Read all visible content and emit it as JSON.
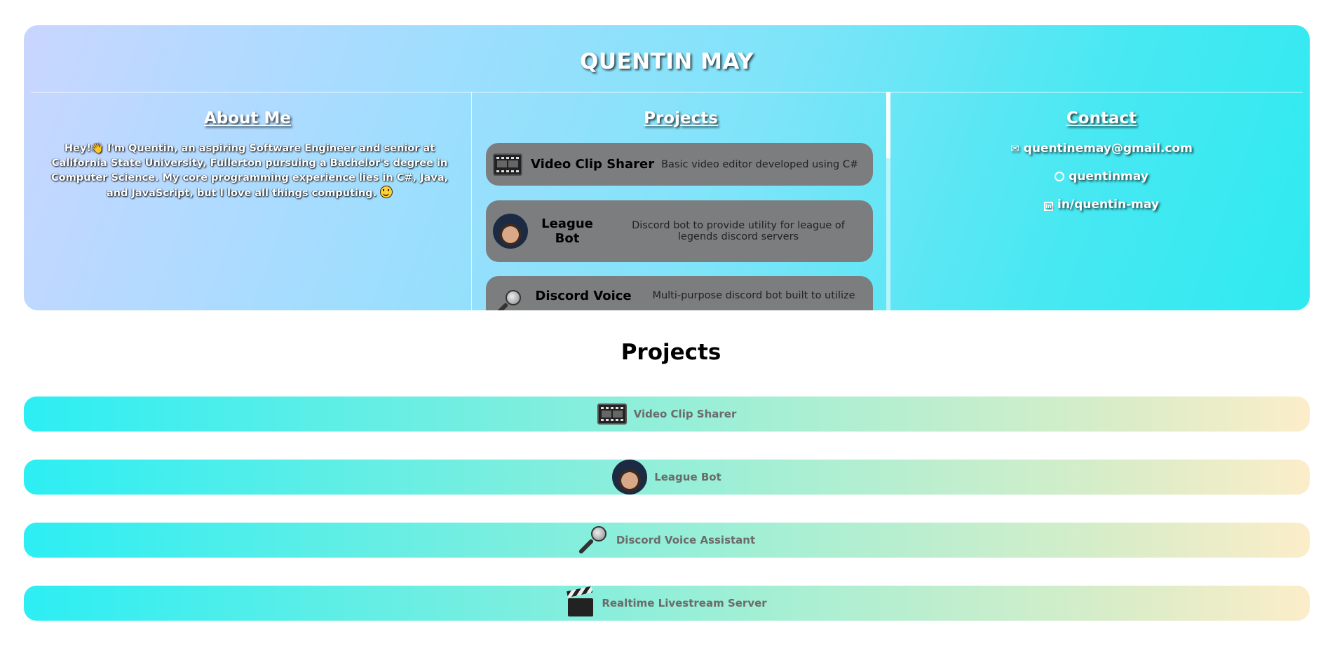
{
  "header": {
    "name": "QUENTIN MAY"
  },
  "about": {
    "heading": "About Me",
    "text": "Hey!👋 I'm Quentin, an aspiring Software Engineer and senior at California State University, Fullerton pursuing a Bachelor's degree in Computer Science. My core programming experience lies in C#, Java, and JavaScript, but I love all things computing."
  },
  "projects_panel": {
    "heading": "Projects",
    "items": [
      {
        "name": "Video Clip Sharer",
        "description": "Basic video editor developed using C#",
        "icon": "film-icon"
      },
      {
        "name": "League Bot",
        "description": "Discord bot to provide utility for league of legends discord servers",
        "icon": "avatar-icon"
      },
      {
        "name": "Discord Voice",
        "description": "Multi-purpose discord bot built to utilize",
        "icon": "microphone-icon"
      }
    ]
  },
  "contact": {
    "heading": "Contact",
    "email": "quentinemay@gmail.com",
    "github": "quentinmay",
    "linkedin": "in/quentin-may"
  },
  "projects_section": {
    "title": "Projects",
    "items": [
      {
        "label": "Video Clip Sharer",
        "icon": "film-icon"
      },
      {
        "label": "League Bot",
        "icon": "avatar-icon"
      },
      {
        "label": "Discord Voice Assistant",
        "icon": "microphone-icon"
      },
      {
        "label": "Realtime Livestream Server",
        "icon": "clapperboard-icon"
      }
    ]
  },
  "colors": {
    "hero_gradient_start": "#c9d6ff",
    "hero_gradient_end": "#2eeaf0",
    "card_bg": "#7b7d7e",
    "pill_gradient_start": "#2ceef3",
    "pill_gradient_end": "#fcedc9"
  }
}
